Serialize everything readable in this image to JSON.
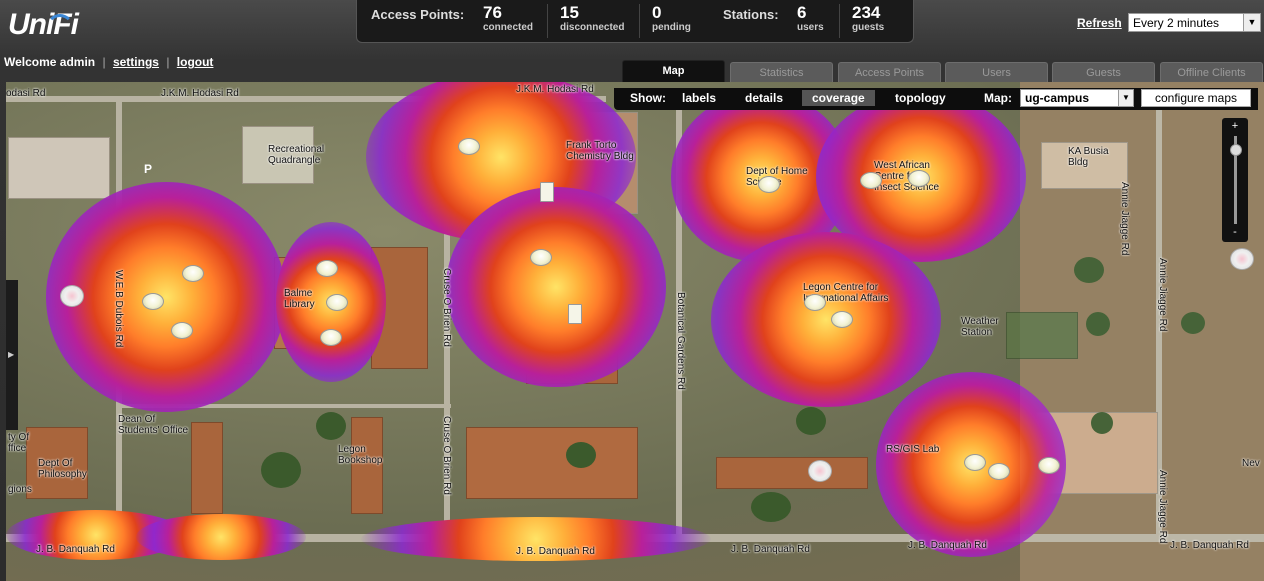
{
  "header": {
    "logo_text": "UniFi",
    "welcome_text": "Welcome admin",
    "settings_link": "settings",
    "logout_link": "logout"
  },
  "stats": {
    "access_points_label": "Access Points:",
    "connected": {
      "value": "76",
      "label": "connected"
    },
    "disconnected": {
      "value": "15",
      "label": "disconnected"
    },
    "pending": {
      "value": "0",
      "label": "pending"
    },
    "stations_label": "Stations:",
    "users": {
      "value": "6",
      "label": "users"
    },
    "guests": {
      "value": "234",
      "label": "guests"
    }
  },
  "refresh": {
    "link": "Refresh",
    "interval": "Every 2 minutes"
  },
  "tabs": [
    {
      "label": "Map",
      "active": true
    },
    {
      "label": "Statistics"
    },
    {
      "label": "Access Points"
    },
    {
      "label": "Users"
    },
    {
      "label": "Guests"
    },
    {
      "label": "Offline Clients"
    }
  ],
  "toolbar": {
    "show_label": "Show:",
    "options": [
      "labels",
      "details",
      "coverage",
      "topology"
    ],
    "active_option": "coverage",
    "map_label": "Map:",
    "map_value": "ug-campus",
    "configure_button": "configure maps"
  },
  "map_labels": {
    "hodasi_left": "odasi Rd",
    "hodasi_mid": "J.K.M. Hodasi Rd",
    "hodasi_right": "J.K.M. Hodasi Rd",
    "recreational": "Recreational\nQuadrangle",
    "frank_torto": "Frank Torto\nChemistry Bldg",
    "dept_home_science": "Dept of Home\nScience",
    "west_african": "West African\nCentre for\nInsect Science",
    "ka_busia": "KA Busia\nBldg",
    "annie_jiagge_1": "Annie Jiagge Rd",
    "annie_jiagge_2": "Annie Jiagge Rd",
    "annie_jiagge_3": "Annie Jiagge Rd",
    "web_dubois": "W.E.B Dubois Rd",
    "balme_library": "Balme\nLibrary",
    "cruse_obrien_1": "Cruse O Brien Rd",
    "cruse_obrien_2": "Cruse O Brien Rd",
    "botanical_gardens": "Botanical Gardens Rd",
    "legon_centre": "Legon Centre for\nInternational Affairs",
    "weather_station": "Weather\nStation",
    "dean_students": "Dean Of\nStudents' Office",
    "legon_bookshop": "Legon\nBookshop",
    "dept_philosophy": "Dept Of\nPhilosophy",
    "dept_left": "ty Of\nffice",
    "religions": "gions",
    "rs_gis": "RS/GIS Lab",
    "danquah_1": "J. B. Danquah Rd",
    "danquah_2": "J. B. Danquah Rd",
    "danquah_3": "J. B. Danquah Rd",
    "danquah_4": "J. B. Danquah Rd",
    "danquah_5": "J. B. Danquah Rd",
    "new_right": "Nev",
    "parking": "P"
  },
  "zoom": {
    "plus": "+",
    "minus": "-",
    "level": 0.9
  },
  "colors": {
    "heat_core": "#ffe466",
    "heat_mid": "#e0421c",
    "heat_edge": "#8c28d2",
    "header_bg": "#333333"
  }
}
